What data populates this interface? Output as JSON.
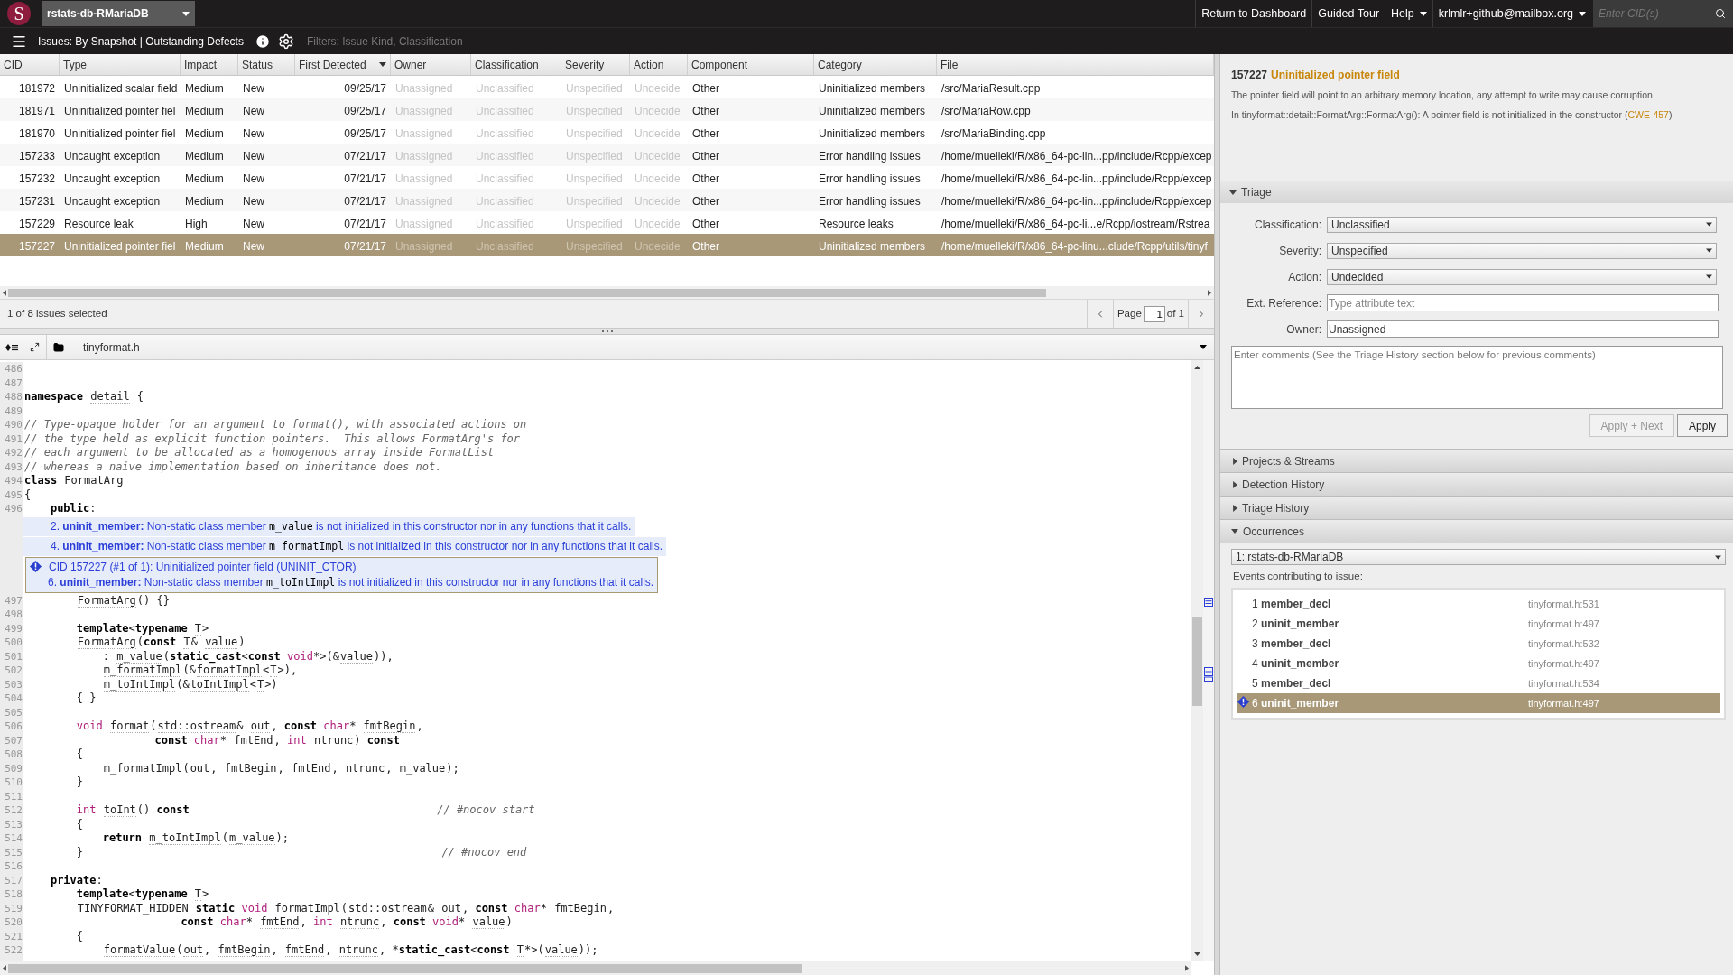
{
  "top_bar": {
    "logo": "S",
    "project": "rstats-db-RMariaDB",
    "links": [
      {
        "label": "Return to Dashboard",
        "kind": "link"
      },
      {
        "label": "Guided Tour",
        "kind": "link"
      },
      {
        "label": "Help",
        "kind": "menu"
      },
      {
        "label": "krlmlr+github@mailbox.org",
        "kind": "menu"
      }
    ],
    "search": {
      "placeholder": "Enter CID(s)"
    }
  },
  "view_bar": {
    "title": "Issues: By Snapshot | Outstanding Defects",
    "filters": "Filters: Issue Kind, Classification"
  },
  "issues_table": {
    "columns": [
      {
        "label": "CID",
        "kind": "id",
        "sorted": false
      },
      {
        "label": "Type",
        "kind": "text",
        "sorted": false
      },
      {
        "label": "Impact",
        "kind": "text",
        "sorted": false
      },
      {
        "label": "Status",
        "kind": "text",
        "sorted": false
      },
      {
        "label": "First Detected",
        "kind": "date",
        "sorted": true
      },
      {
        "label": "Owner",
        "kind": "unset",
        "sorted": false
      },
      {
        "label": "Classification",
        "kind": "unset",
        "sorted": false
      },
      {
        "label": "Severity",
        "kind": "unset",
        "sorted": false
      },
      {
        "label": "Action",
        "kind": "unset",
        "sorted": false
      },
      {
        "label": "Component",
        "kind": "text",
        "sorted": false
      },
      {
        "label": "Category",
        "kind": "text",
        "sorted": false
      },
      {
        "label": "File",
        "kind": "text",
        "sorted": false
      }
    ],
    "rows": [
      {
        "selected": false,
        "cells": [
          "181972",
          "Uninitialized scalar field",
          "Medium",
          "New",
          "09/25/17",
          "Unassigned",
          "Unclassified",
          "Unspecified",
          "Undecide",
          "Other",
          "Uninitialized members",
          "/src/MariaResult.cpp"
        ]
      },
      {
        "selected": false,
        "cells": [
          "181971",
          "Uninitialized pointer fiel",
          "Medium",
          "New",
          "09/25/17",
          "Unassigned",
          "Unclassified",
          "Unspecified",
          "Undecide",
          "Other",
          "Uninitialized members",
          "/src/MariaRow.cpp"
        ]
      },
      {
        "selected": false,
        "cells": [
          "181970",
          "Uninitialized pointer fiel",
          "Medium",
          "New",
          "09/25/17",
          "Unassigned",
          "Unclassified",
          "Unspecified",
          "Undecide",
          "Other",
          "Uninitialized members",
          "/src/MariaBinding.cpp"
        ]
      },
      {
        "selected": false,
        "cells": [
          "157233",
          "Uncaught exception",
          "Medium",
          "New",
          "07/21/17",
          "Unassigned",
          "Unclassified",
          "Unspecified",
          "Undecide",
          "Other",
          "Error handling issues",
          "/home/muelleki/R/x86_64-pc-lin...pp/include/Rcpp/excep"
        ]
      },
      {
        "selected": false,
        "cells": [
          "157232",
          "Uncaught exception",
          "Medium",
          "New",
          "07/21/17",
          "Unassigned",
          "Unclassified",
          "Unspecified",
          "Undecide",
          "Other",
          "Error handling issues",
          "/home/muelleki/R/x86_64-pc-lin...pp/include/Rcpp/excep"
        ]
      },
      {
        "selected": false,
        "cells": [
          "157231",
          "Uncaught exception",
          "Medium",
          "New",
          "07/21/17",
          "Unassigned",
          "Unclassified",
          "Unspecified",
          "Undecide",
          "Other",
          "Error handling issues",
          "/home/muelleki/R/x86_64-pc-lin...pp/include/Rcpp/excep"
        ]
      },
      {
        "selected": false,
        "cells": [
          "157229",
          "Resource leak",
          "High",
          "New",
          "07/21/17",
          "Unassigned",
          "Unclassified",
          "Unspecified",
          "Undecide",
          "Other",
          "Resource leaks",
          "/home/muelleki/R/x86_64-pc-li...e/Rcpp/iostream/Rstrea"
        ]
      },
      {
        "selected": true,
        "cells": [
          "157227",
          "Uninitialized pointer fiel",
          "Medium",
          "New",
          "07/21/17",
          "Unassigned",
          "Unclassified",
          "Unspecified",
          "Undecide",
          "Other",
          "Uninitialized members",
          "/home/muelleki/R/x86_64-pc-linu...clude/Rcpp/utils/tinyf"
        ]
      }
    ]
  },
  "status": "1 of 8 issues selected",
  "pager": {
    "label": "Page",
    "page": "1",
    "total": "of 1"
  },
  "editor": {
    "file": "tinyformat.h",
    "lines": [
      {
        "kind": "code",
        "number": "486"
      },
      {
        "kind": "code",
        "number": "487"
      },
      {
        "kind": "code",
        "number": "488",
        "tokens": [
          {
            "kind": "keyword",
            "text": "namespace"
          },
          {
            "kind": "name",
            "text": " detail"
          },
          {
            "kind": "plain",
            "text": " {"
          }
        ]
      },
      {
        "kind": "code",
        "number": "489"
      },
      {
        "kind": "code",
        "number": "490",
        "tokens": [
          {
            "kind": "comment",
            "text": "// Type-opaque holder for an argument to format(), with associated actions on"
          }
        ]
      },
      {
        "kind": "code",
        "number": "491",
        "tokens": [
          {
            "kind": "comment",
            "text": "// the type held as explicit function pointers.  This allows FormatArg's for"
          }
        ]
      },
      {
        "kind": "code",
        "number": "492",
        "tokens": [
          {
            "kind": "comment",
            "text": "// each argument to be allocated as a homogenous array inside FormatList"
          }
        ]
      },
      {
        "kind": "code",
        "number": "493",
        "tokens": [
          {
            "kind": "comment",
            "text": "// whereas a naive implementation based on inheritance does not."
          }
        ]
      },
      {
        "kind": "code",
        "number": "494",
        "tokens": [
          {
            "kind": "keyword",
            "text": "class"
          },
          {
            "kind": "name",
            "text": " FormatArg"
          }
        ]
      },
      {
        "kind": "code",
        "number": "495",
        "tokens": [
          {
            "kind": "plain",
            "text": "{"
          }
        ]
      },
      {
        "kind": "code",
        "number": "496",
        "tokens": [
          {
            "kind": "keyword",
            "text": "    public"
          },
          {
            "kind": "plain",
            "text": ":"
          }
        ]
      },
      {
        "kind": "event",
        "number": "2.",
        "tag": "uninit_member:",
        "before": "Non-static class member",
        "member": "m_value",
        "after": "is not initialized in this constructor nor in any functions that it calls."
      },
      {
        "kind": "event",
        "number": "4.",
        "tag": "uninit_member:",
        "before": "Non-static class member",
        "member": "m_formatImpl",
        "after": "is not initialized in this constructor nor in any functions that it calls."
      },
      {
        "kind": "issue",
        "title": "CID 157227 (#1 of 1): Uninitialized pointer field (UNINIT_CTOR)",
        "event": {
          "number": "6.",
          "tag": "uninit_member:",
          "before": "Non-static class member",
          "member": "m_toIntImpl",
          "after": "is not initialized in this constructor nor in any functions that it calls."
        }
      },
      {
        "kind": "code",
        "number": "497",
        "tokens": [
          {
            "kind": "name",
            "text": "        FormatArg"
          },
          {
            "kind": "plain",
            "text": "() {}"
          }
        ]
      },
      {
        "kind": "code",
        "number": "498"
      },
      {
        "kind": "code",
        "number": "499",
        "tokens": [
          {
            "kind": "keyword",
            "text": "        template"
          },
          {
            "kind": "plain",
            "text": "<"
          },
          {
            "kind": "keyword",
            "text": "typename"
          },
          {
            "kind": "name",
            "text": " T"
          },
          {
            "kind": "plain",
            "text": ">"
          }
        ]
      },
      {
        "kind": "code",
        "number": "500",
        "tokens": [
          {
            "kind": "name",
            "text": "        FormatArg"
          },
          {
            "kind": "plain",
            "text": "("
          },
          {
            "kind": "keyword",
            "text": "const"
          },
          {
            "kind": "name",
            "text": " T"
          },
          {
            "kind": "plain",
            "text": "&"
          },
          {
            "kind": "name",
            "text": " value"
          },
          {
            "kind": "plain",
            "text": ")"
          }
        ]
      },
      {
        "kind": "code",
        "number": "501",
        "tokens": [
          {
            "kind": "plain",
            "text": "            :"
          },
          {
            "kind": "name",
            "text": " m_value"
          },
          {
            "kind": "plain",
            "text": "("
          },
          {
            "kind": "keyword",
            "text": "static_cast"
          },
          {
            "kind": "plain",
            "text": "<"
          },
          {
            "kind": "keyword",
            "text": "const"
          },
          {
            "kind": "type",
            "text": " void"
          },
          {
            "kind": "plain",
            "text": "*>(&"
          },
          {
            "kind": "name",
            "text": "value"
          },
          {
            "kind": "plain",
            "text": ")),"
          }
        ]
      },
      {
        "kind": "code",
        "number": "502",
        "tokens": [
          {
            "kind": "name",
            "text": "            m_formatImpl"
          },
          {
            "kind": "plain",
            "text": "(&"
          },
          {
            "kind": "name",
            "text": "formatImpl"
          },
          {
            "kind": "plain",
            "text": "<"
          },
          {
            "kind": "name",
            "text": "T"
          },
          {
            "kind": "plain",
            "text": ">),"
          }
        ]
      },
      {
        "kind": "code",
        "number": "503",
        "tokens": [
          {
            "kind": "name",
            "text": "            m_toIntImpl"
          },
          {
            "kind": "plain",
            "text": "(&"
          },
          {
            "kind": "name",
            "text": "toIntImpl"
          },
          {
            "kind": "plain",
            "text": "<"
          },
          {
            "kind": "name",
            "text": "T"
          },
          {
            "kind": "plain",
            "text": ">)"
          }
        ]
      },
      {
        "kind": "code",
        "number": "504",
        "tokens": [
          {
            "kind": "plain",
            "text": "        { }"
          }
        ]
      },
      {
        "kind": "code",
        "number": "505"
      },
      {
        "kind": "code",
        "number": "506",
        "tokens": [
          {
            "kind": "type",
            "text": "        void"
          },
          {
            "kind": "name",
            "text": " format"
          },
          {
            "kind": "plain",
            "text": "("
          },
          {
            "kind": "name",
            "text": "std::ostream"
          },
          {
            "kind": "plain",
            "text": "&"
          },
          {
            "kind": "name",
            "text": " out"
          },
          {
            "kind": "plain",
            "text": ","
          },
          {
            "kind": "keyword",
            "text": " const"
          },
          {
            "kind": "type",
            "text": " char"
          },
          {
            "kind": "plain",
            "text": "*"
          },
          {
            "kind": "name",
            "text": " fmtBegin"
          },
          {
            "kind": "plain",
            "text": ","
          }
        ]
      },
      {
        "kind": "code",
        "number": "507",
        "tokens": [
          {
            "kind": "keyword",
            "text": "                    const"
          },
          {
            "kind": "type",
            "text": " char"
          },
          {
            "kind": "plain",
            "text": "*"
          },
          {
            "kind": "name",
            "text": " fmtEnd"
          },
          {
            "kind": "plain",
            "text": ","
          },
          {
            "kind": "type",
            "text": " int"
          },
          {
            "kind": "name",
            "text": " ntrunc"
          },
          {
            "kind": "plain",
            "text": ")"
          },
          {
            "kind": "keyword",
            "text": " const"
          }
        ]
      },
      {
        "kind": "code",
        "number": "508",
        "tokens": [
          {
            "kind": "plain",
            "text": "        {"
          }
        ]
      },
      {
        "kind": "code",
        "number": "509",
        "tokens": [
          {
            "kind": "name",
            "text": "            m_formatImpl"
          },
          {
            "kind": "plain",
            "text": "("
          },
          {
            "kind": "name",
            "text": "out"
          },
          {
            "kind": "plain",
            "text": ","
          },
          {
            "kind": "name",
            "text": " fmtBegin"
          },
          {
            "kind": "plain",
            "text": ","
          },
          {
            "kind": "name",
            "text": " fmtEnd"
          },
          {
            "kind": "plain",
            "text": ","
          },
          {
            "kind": "name",
            "text": " ntrunc"
          },
          {
            "kind": "plain",
            "text": ","
          },
          {
            "kind": "name",
            "text": " m_value"
          },
          {
            "kind": "plain",
            "text": ");"
          }
        ]
      },
      {
        "kind": "code",
        "number": "510",
        "tokens": [
          {
            "kind": "plain",
            "text": "        }"
          }
        ]
      },
      {
        "kind": "code",
        "number": "511"
      },
      {
        "kind": "code",
        "number": "512",
        "tokens": [
          {
            "kind": "type",
            "text": "        int"
          },
          {
            "kind": "name",
            "text": " toInt"
          },
          {
            "kind": "plain",
            "text": "()"
          },
          {
            "kind": "keyword",
            "text": " const"
          },
          {
            "kind": "comment",
            "text": "                                      // #nocov start"
          }
        ]
      },
      {
        "kind": "code",
        "number": "513",
        "tokens": [
          {
            "kind": "plain",
            "text": "        {"
          }
        ]
      },
      {
        "kind": "code",
        "number": "514",
        "tokens": [
          {
            "kind": "keyword",
            "text": "            return"
          },
          {
            "kind": "name",
            "text": " m_toIntImpl"
          },
          {
            "kind": "plain",
            "text": "("
          },
          {
            "kind": "name",
            "text": "m_value"
          },
          {
            "kind": "plain",
            "text": ");"
          }
        ]
      },
      {
        "kind": "code",
        "number": "515",
        "tokens": [
          {
            "kind": "plain",
            "text": "        }"
          },
          {
            "kind": "comment",
            "text": "                                                       // #nocov end"
          }
        ]
      },
      {
        "kind": "code",
        "number": "516"
      },
      {
        "kind": "code",
        "number": "517",
        "tokens": [
          {
            "kind": "keyword",
            "text": "    private"
          },
          {
            "kind": "plain",
            "text": ":"
          }
        ]
      },
      {
        "kind": "code",
        "number": "518",
        "tokens": [
          {
            "kind": "keyword",
            "text": "        template"
          },
          {
            "kind": "plain",
            "text": "<"
          },
          {
            "kind": "keyword",
            "text": "typename"
          },
          {
            "kind": "name",
            "text": " T"
          },
          {
            "kind": "plain",
            "text": ">"
          }
        ]
      },
      {
        "kind": "code",
        "number": "519",
        "tokens": [
          {
            "kind": "name",
            "text": "        TINYFORMAT_HIDDEN"
          },
          {
            "kind": "keyword",
            "text": " static"
          },
          {
            "kind": "type",
            "text": " void"
          },
          {
            "kind": "name",
            "text": " formatImpl"
          },
          {
            "kind": "plain",
            "text": "("
          },
          {
            "kind": "name",
            "text": "std::ostream"
          },
          {
            "kind": "plain",
            "text": "&"
          },
          {
            "kind": "name",
            "text": " out"
          },
          {
            "kind": "plain",
            "text": ","
          },
          {
            "kind": "keyword",
            "text": " const"
          },
          {
            "kind": "type",
            "text": " char"
          },
          {
            "kind": "plain",
            "text": "*"
          },
          {
            "kind": "name",
            "text": " fmtBegin"
          },
          {
            "kind": "plain",
            "text": ","
          }
        ]
      },
      {
        "kind": "code",
        "number": "520",
        "tokens": [
          {
            "kind": "keyword",
            "text": "                        const"
          },
          {
            "kind": "type",
            "text": " char"
          },
          {
            "kind": "plain",
            "text": "*"
          },
          {
            "kind": "name",
            "text": " fmtEnd"
          },
          {
            "kind": "plain",
            "text": ","
          },
          {
            "kind": "type",
            "text": " int"
          },
          {
            "kind": "name",
            "text": " ntrunc"
          },
          {
            "kind": "plain",
            "text": ","
          },
          {
            "kind": "keyword",
            "text": " const"
          },
          {
            "kind": "type",
            "text": " void"
          },
          {
            "kind": "plain",
            "text": "*"
          },
          {
            "kind": "name",
            "text": " value"
          },
          {
            "kind": "plain",
            "text": ")"
          }
        ]
      },
      {
        "kind": "code",
        "number": "521",
        "tokens": [
          {
            "kind": "plain",
            "text": "        {"
          }
        ]
      },
      {
        "kind": "code",
        "number": "522",
        "tokens": [
          {
            "kind": "name",
            "text": "            formatValue"
          },
          {
            "kind": "plain",
            "text": "("
          },
          {
            "kind": "name",
            "text": "out"
          },
          {
            "kind": "plain",
            "text": ","
          },
          {
            "kind": "name",
            "text": " fmtBegin"
          },
          {
            "kind": "plain",
            "text": ","
          },
          {
            "kind": "name",
            "text": " fmtEnd"
          },
          {
            "kind": "plain",
            "text": ","
          },
          {
            "kind": "name",
            "text": " ntrunc"
          },
          {
            "kind": "plain",
            "text": ", *"
          },
          {
            "kind": "keyword",
            "text": "static_cast"
          },
          {
            "kind": "plain",
            "text": "<"
          },
          {
            "kind": "keyword",
            "text": "const"
          },
          {
            "kind": "name",
            "text": " T"
          },
          {
            "kind": "plain",
            "text": "*>("
          },
          {
            "kind": "name",
            "text": "value"
          },
          {
            "kind": "plain",
            "text": "));"
          }
        ]
      }
    ]
  },
  "issue_panel": {
    "cid": "157227",
    "title": "Uninitialized pointer field",
    "description": "The pointer field will point to an arbitrary memory location, any attempt to write may cause corruption.",
    "detail": {
      "text": "In tinyformat::detail::FormatArg::FormatArg(): A pointer field is not initialized in the constructor (",
      "link": "CWE-457",
      "end": ")"
    },
    "triage": {
      "title": "Triage",
      "expanded": true,
      "fields": [
        {
          "label": "Classification:",
          "kind": "select",
          "value": "Unclassified"
        },
        {
          "label": "Severity:",
          "kind": "select",
          "value": "Unspecified"
        },
        {
          "label": "Action:",
          "kind": "select",
          "value": "Undecided"
        },
        {
          "label": "Ext. Reference:",
          "kind": "text",
          "placeholder": "Type attribute text"
        },
        {
          "label": "Owner:",
          "kind": "text",
          "value": "Unassigned"
        }
      ],
      "comments": {
        "placeholder": "Enter comments (See the Triage History section below for previous comments)"
      },
      "buttons": [
        {
          "label": "Apply + Next",
          "disabled": true
        },
        {
          "label": "Apply",
          "disabled": false
        }
      ]
    },
    "sections": [
      {
        "title": "Projects & Streams",
        "expanded": false
      },
      {
        "title": "Detection History",
        "expanded": false
      },
      {
        "title": "Triage History",
        "expanded": false
      }
    ],
    "occurrences": {
      "title": "Occurrences",
      "expanded": true,
      "stream": "1: rstats-db-RMariaDB",
      "events_label": "Events contributing to issue:",
      "events": [
        {
          "number": "1",
          "name": "member_decl",
          "location": "tinyformat.h:531",
          "selected": false
        },
        {
          "number": "2",
          "name": "uninit_member",
          "location": "tinyformat.h:497",
          "selected": false
        },
        {
          "number": "3",
          "name": "member_decl",
          "location": "tinyformat.h:532",
          "selected": false
        },
        {
          "number": "4",
          "name": "uninit_member",
          "location": "tinyformat.h:497",
          "selected": false
        },
        {
          "number": "5",
          "name": "member_decl",
          "location": "tinyformat.h:534",
          "selected": false
        },
        {
          "number": "6",
          "name": "uninit_member",
          "location": "tinyformat.h:497",
          "selected": true
        }
      ]
    }
  }
}
